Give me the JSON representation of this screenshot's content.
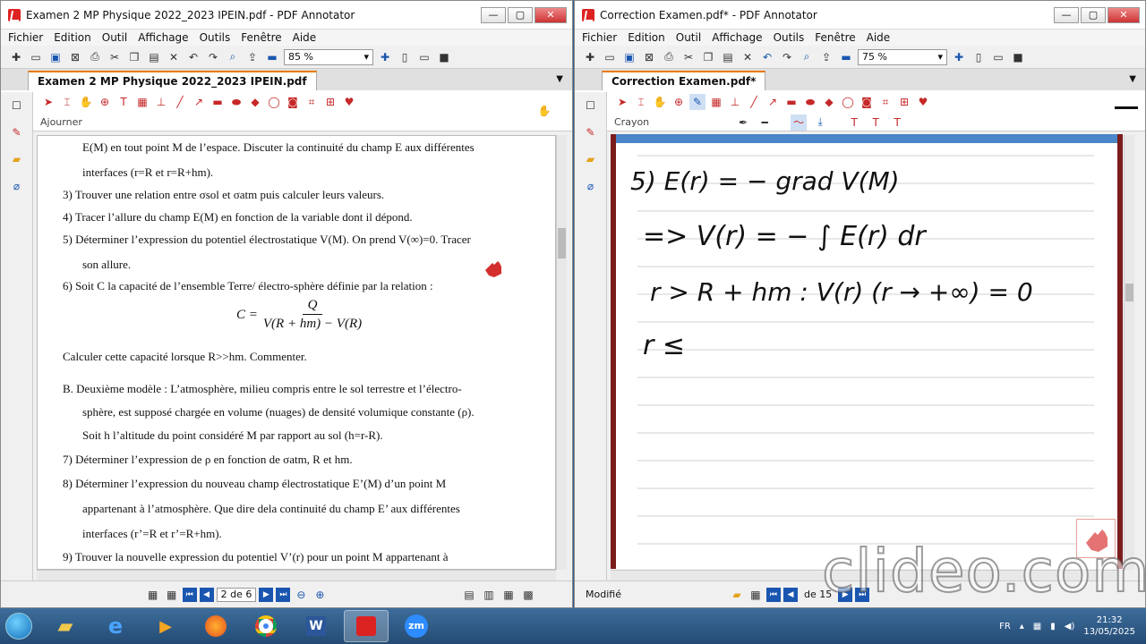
{
  "left_window": {
    "title": "Examen 2 MP Physique 2022_2023 IPEIN.pdf - PDF Annotator",
    "menu": [
      "Fichier",
      "Edition",
      "Outil",
      "Affichage",
      "Outils",
      "Fenêtre",
      "Aide"
    ],
    "zoom": "85 %",
    "tab": "Examen 2 MP Physique 2022_2023 IPEIN.pdf",
    "tool_label": "Ajourner",
    "page_current": "2",
    "page_label": "2 de 6",
    "document_lines": [
      "E(M) en tout point M de l’espace. Discuter la continuité du champ E aux différentes",
      "interfaces (r=R et r=R+hm).",
      "3)  Trouver une relation entre σsol et σatm puis calculer leurs valeurs.",
      "4)  Tracer l’allure du champ E(M) en fonction de la variable dont il dépond.",
      "5)  Déterminer l’expression du potentiel électrostatique V(M). On prend V(∞)=0. Tracer",
      "son allure.",
      "6)  Soit C la capacité de l’ensemble Terre/ électro-sphère définie par la relation :",
      "Calculer cette capacité lorsque R>>hm. Commenter.",
      "B.  Deuxième modèle : L’atmosphère, milieu compris entre le sol terrestre et l’électro-",
      "sphère, est supposé chargée en volume (nuages) de densité volumique constante (ρ).",
      "Soit h l’altitude du point considéré M par rapport au sol (h=r-R).",
      "7)  Déterminer l’expression de ρ en fonction de σatm, R et hm.",
      "8)  Déterminer l’expression du nouveau champ électrostatique E’(M) d’un point M",
      "appartenant à l’atmosphère. Que dire dela continuité du champ E’ aux différentes",
      "interfaces (r’=R et r’=R+hm).",
      "9)  Trouver la nouvelle expression du potentiel V’(r) pour un point M appartenant à"
    ],
    "formula_lhs": "C =",
    "formula_num": "Q",
    "formula_den": "V(R + hm) − V(R)"
  },
  "right_window": {
    "title": "Correction Examen.pdf* - PDF Annotator",
    "menu": [
      "Fichier",
      "Edition",
      "Outil",
      "Affichage",
      "Outils",
      "Fenêtre",
      "Aide"
    ],
    "zoom": "75 %",
    "tab": "Correction Examen.pdf*",
    "tool_label": "Crayon",
    "status": "Modifié",
    "page_label": "de 15",
    "handwriting": [
      "5) E(r) = − grad V(M)",
      "=> V(r) = − ∫ E(r) dr",
      "r > R + hm : V(r) (r → +∞) = 0",
      "r ≤"
    ]
  },
  "taskbar": {
    "lang": "FR",
    "time": "21:32",
    "date": "13/05/2025"
  },
  "watermark": "clideo.com",
  "colors": {
    "accent_red": "#c62828",
    "nav_blue": "#1a56b0",
    "tab_orange": "#e87a00"
  }
}
